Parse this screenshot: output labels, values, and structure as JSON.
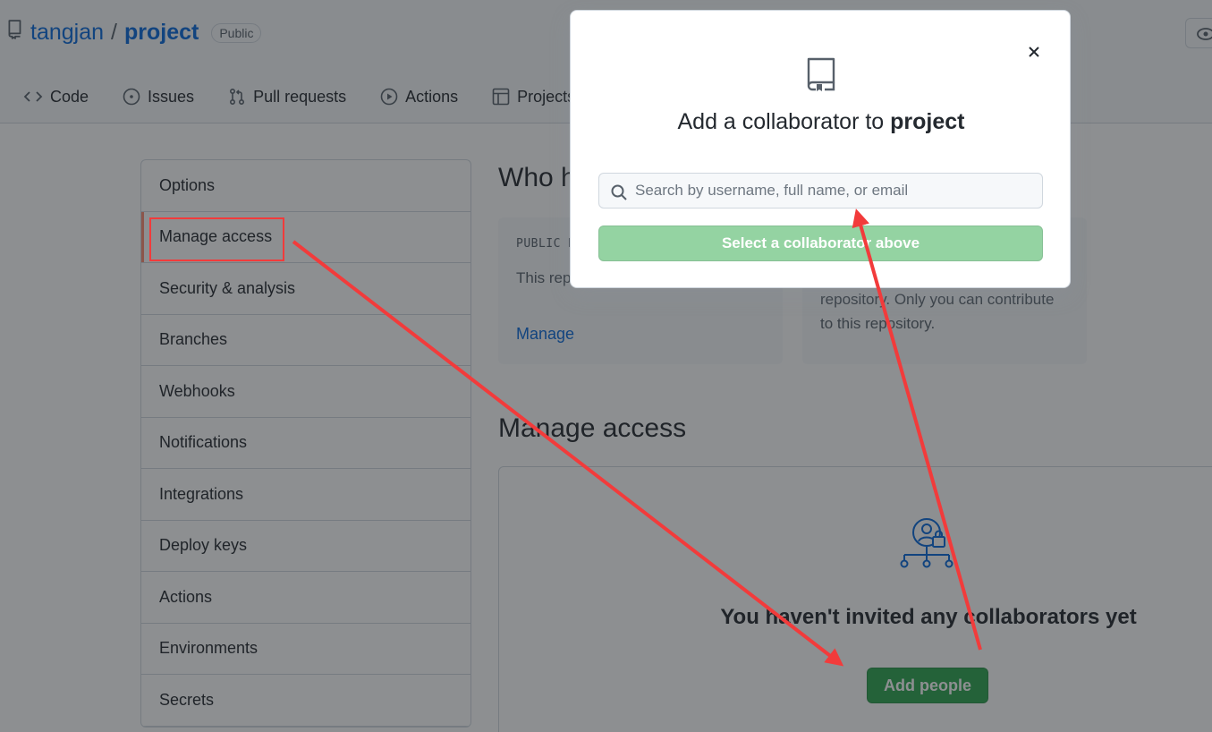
{
  "repo": {
    "owner": "tangjan",
    "separator": "/",
    "name": "project",
    "visibility": "Public"
  },
  "nav": [
    {
      "label": "Code",
      "icon": "code-icon"
    },
    {
      "label": "Issues",
      "icon": "issue-icon"
    },
    {
      "label": "Pull requests",
      "icon": "pull-request-icon"
    },
    {
      "label": "Actions",
      "icon": "play-icon"
    },
    {
      "label": "Projects",
      "icon": "table-icon"
    }
  ],
  "sidebar": {
    "items": [
      {
        "label": "Options"
      },
      {
        "label": "Manage access"
      },
      {
        "label": "Security & analysis"
      },
      {
        "label": "Branches"
      },
      {
        "label": "Webhooks"
      },
      {
        "label": "Notifications"
      },
      {
        "label": "Integrations"
      },
      {
        "label": "Deploy keys"
      },
      {
        "label": "Actions"
      },
      {
        "label": "Environments"
      },
      {
        "label": "Secrets"
      }
    ]
  },
  "main": {
    "who_heading": "Who h",
    "public_card": {
      "label": "PUBLIC R",
      "text": "This rep to anyone.",
      "link": "Manage"
    },
    "private_card": {
      "text": "repository. Only you can contribute to this repository."
    },
    "manage_heading": "Manage access",
    "empty_text": "You haven't invited any collaborators yet",
    "add_people": "Add people"
  },
  "modal": {
    "title_prefix": "Add a collaborator to",
    "title_repo": "project",
    "search_placeholder": "Search by username, full name, or email",
    "select_button": "Select a collaborator above",
    "close_icon": "close-icon"
  },
  "colors": {
    "accent": "#0969da",
    "annotation": "#f23b3b",
    "primary_button": "#2da44e",
    "disabled_button": "#94d3a2"
  }
}
